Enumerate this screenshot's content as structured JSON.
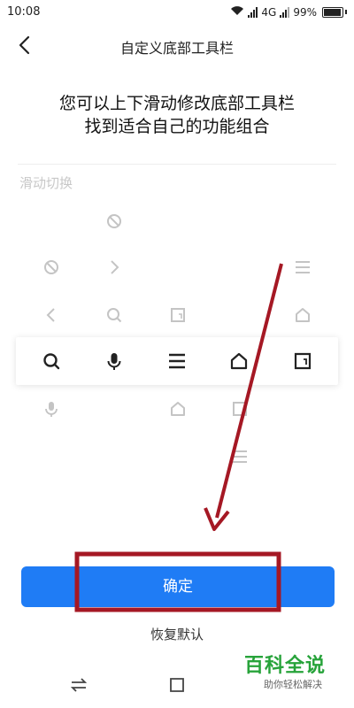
{
  "status_bar": {
    "time": "10:08",
    "network": "4G",
    "battery": "99%"
  },
  "header": {
    "title": "自定义底部工具栏",
    "back_icon": "back-arrow-icon"
  },
  "instruction": {
    "line1": "您可以上下滑动修改底部工具栏",
    "line2": "找到适合自己的功能组合"
  },
  "hint": "滑动切换",
  "selected_row": {
    "icons": [
      "search-icon",
      "microphone-icon",
      "menu-icon",
      "home-icon",
      "tabs-icon"
    ]
  },
  "actions": {
    "confirm": "确定",
    "restore_default": "恢复默认"
  },
  "colors": {
    "accent": "#1f7cf5",
    "annotation": "#a51824",
    "watermark_green": "#27a33a"
  },
  "watermark": {
    "title": "百科全说",
    "subtitle": "助你轻松解决"
  }
}
